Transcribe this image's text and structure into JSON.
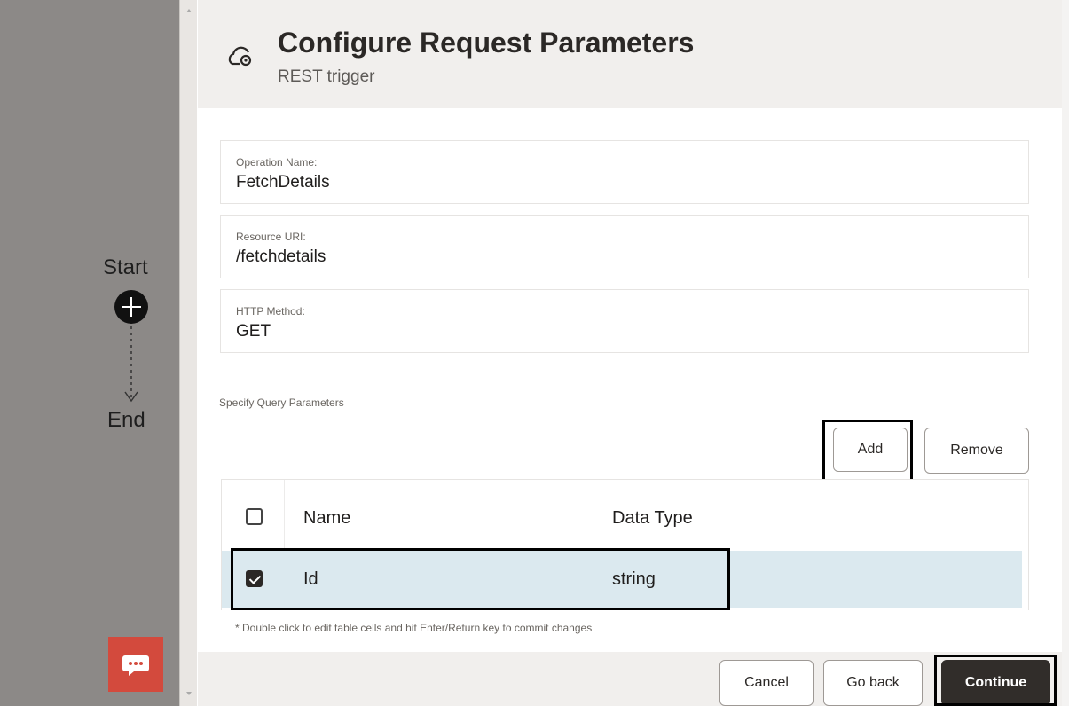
{
  "canvas": {
    "start_label": "Start",
    "end_label": "End",
    "chat_icon": "chat-icon"
  },
  "dialog": {
    "title": "Configure Request Parameters",
    "subtitle": "REST trigger",
    "header_icon": "cloud-gear-icon",
    "fields": {
      "operation_name": {
        "label": "Operation Name:",
        "value": "FetchDetails"
      },
      "resource_uri": {
        "label": "Resource URI:",
        "value": "/fetchdetails"
      },
      "http_method": {
        "label": "HTTP Method:",
        "value": "GET"
      }
    },
    "query_params": {
      "label": "Specify Query Parameters",
      "add_label": "Add",
      "remove_label": "Remove",
      "table": {
        "headers": {
          "name": "Name",
          "type": "Data Type"
        },
        "rows": [
          {
            "checked": true,
            "name": "Id",
            "type": "string"
          }
        ]
      },
      "hint": "* Double click to edit table cells and hit Enter/Return key to commit changes"
    },
    "footer": {
      "cancel_label": "Cancel",
      "back_label": "Go back",
      "continue_label": "Continue"
    }
  },
  "colors": {
    "canvas_bg": "#8c8987",
    "header_bg": "#f1efed",
    "selected_row": "#dbe9ef",
    "primary_button": "#312d2a",
    "chat_button": "#d34a3d"
  }
}
